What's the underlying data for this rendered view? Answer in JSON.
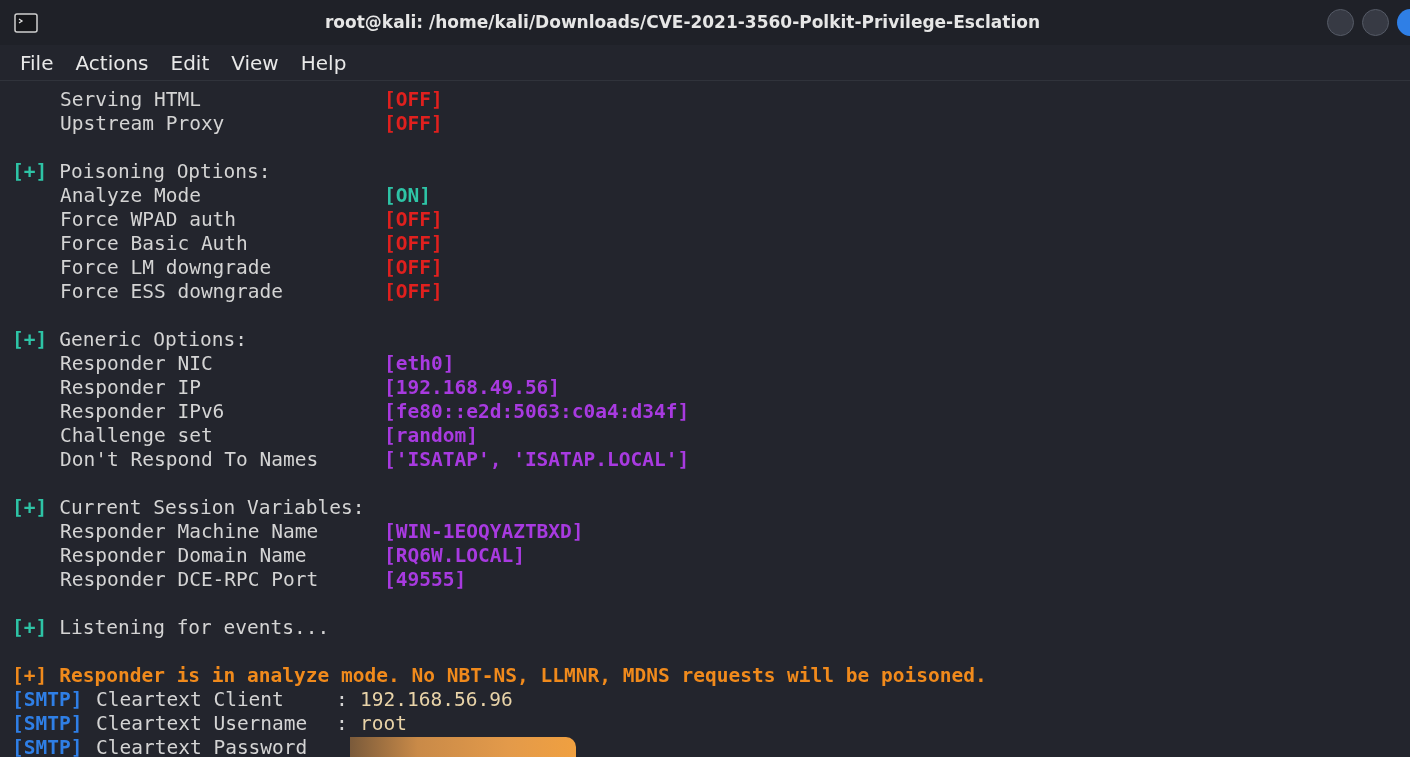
{
  "window": {
    "title": "root@kali: /home/kali/Downloads/CVE-2021-3560-Polkit-Privilege-Esclation"
  },
  "menu": [
    "File",
    "Actions",
    "Edit",
    "View",
    "Help"
  ],
  "lines": [
    {
      "kind": "option",
      "label": "Serving HTML",
      "value": "[OFF]",
      "color": "#e0201e"
    },
    {
      "kind": "option",
      "label": "Upstream Proxy",
      "value": "[OFF]",
      "color": "#e0201e"
    },
    {
      "kind": "gap"
    },
    {
      "kind": "section",
      "marker": "[+]",
      "text": "Poisoning Options:"
    },
    {
      "kind": "option",
      "label": "Analyze Mode",
      "value": "[ON]",
      "color": "#2ec4a6"
    },
    {
      "kind": "option",
      "label": "Force WPAD auth",
      "value": "[OFF]",
      "color": "#e0201e"
    },
    {
      "kind": "option",
      "label": "Force Basic Auth",
      "value": "[OFF]",
      "color": "#e0201e"
    },
    {
      "kind": "option",
      "label": "Force LM downgrade",
      "value": "[OFF]",
      "color": "#e0201e"
    },
    {
      "kind": "option",
      "label": "Force ESS downgrade",
      "value": "[OFF]",
      "color": "#e0201e"
    },
    {
      "kind": "gap"
    },
    {
      "kind": "section",
      "marker": "[+]",
      "text": "Generic Options:"
    },
    {
      "kind": "option",
      "label": "Responder NIC",
      "value": "[eth0]",
      "color": "#a83ae0"
    },
    {
      "kind": "option",
      "label": "Responder IP",
      "value": "[192.168.49.56]",
      "color": "#a83ae0"
    },
    {
      "kind": "option",
      "label": "Responder IPv6",
      "value": "[fe80::e2d:5063:c0a4:d34f]",
      "color": "#a83ae0"
    },
    {
      "kind": "option",
      "label": "Challenge set",
      "value": "[random]",
      "color": "#a83ae0"
    },
    {
      "kind": "option",
      "label": "Don't Respond To Names",
      "value": "['ISATAP', 'ISATAP.LOCAL']",
      "color": "#a83ae0"
    },
    {
      "kind": "gap"
    },
    {
      "kind": "section",
      "marker": "[+]",
      "text": "Current Session Variables:"
    },
    {
      "kind": "option",
      "label": "Responder Machine Name",
      "value": "[WIN-1EOQYAZTBXD]",
      "color": "#a83ae0"
    },
    {
      "kind": "option",
      "label": "Responder Domain Name",
      "value": "[RQ6W.LOCAL]",
      "color": "#a83ae0"
    },
    {
      "kind": "option",
      "label": "Responder DCE-RPC Port",
      "value": "[49555]",
      "color": "#a83ae0"
    },
    {
      "kind": "gap"
    },
    {
      "kind": "section",
      "marker": "[+]",
      "text": "Listening for events..."
    },
    {
      "kind": "gap"
    },
    {
      "kind": "alert",
      "marker": "[+]",
      "text": "Responder is in analyze mode. No NBT-NS, LLMNR, MDNS requests will be poisoned."
    },
    {
      "kind": "log",
      "tag": "[SMTP]",
      "label": "Cleartext Client",
      "sep": ":",
      "value": "192.168.56.96",
      "redacted": false
    },
    {
      "kind": "log",
      "tag": "[SMTP]",
      "label": "Cleartext Username",
      "sep": ":",
      "value": "root",
      "redacted": false
    },
    {
      "kind": "log",
      "tag": "[SMTP]",
      "label": "Cleartext Password",
      "redacted": true
    }
  ]
}
